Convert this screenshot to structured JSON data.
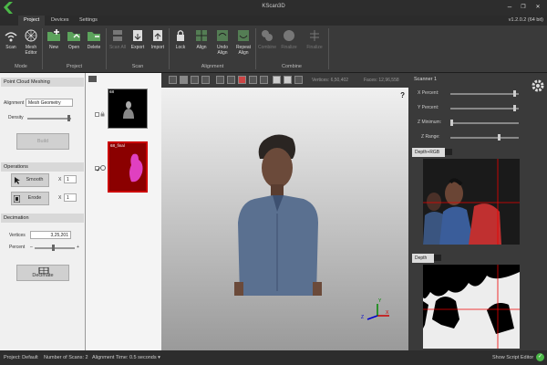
{
  "window": {
    "title": "KScan3D",
    "version": "v1.2.0.2 (64 bit)",
    "tabs": [
      "Project",
      "Devices",
      "Settings"
    ],
    "minimize": "–",
    "maximize": "❐",
    "close": "✕"
  },
  "ribbon": {
    "mode": {
      "label": "Mode",
      "buttons": [
        "Scan",
        "Mesh Editor"
      ]
    },
    "project": {
      "label": "Project",
      "buttons": [
        "New",
        "Open",
        "Delete"
      ]
    },
    "scan": {
      "label": "Scan",
      "buttons": [
        "Scan All",
        "Export",
        "Import"
      ]
    },
    "alignment": {
      "label": "Alignment",
      "buttons": [
        "Lock",
        "Align",
        "Undo Align",
        "Repeat Align"
      ]
    },
    "combine": {
      "label": "Combine",
      "buttons": [
        "Combine",
        "Finalize",
        "Finalize"
      ]
    }
  },
  "left_panel": {
    "meshing": {
      "header": "Point Cloud Meshing",
      "alignment_label": "Alignment",
      "alignment_value": "Mesh Geometry",
      "density_label": "Density",
      "build_label": "Build"
    },
    "operations": {
      "header": "Operations",
      "smooth_label": "Smooth",
      "smooth_x": "X",
      "smooth_value": "1",
      "erode_label": "Erode",
      "erode_x": "X",
      "erode_value": "1"
    },
    "decimation": {
      "header": "Decimation",
      "vertices_label": "Vertices",
      "vertices_value": "3,25,201",
      "percent_label": "Percent",
      "minus": "–",
      "plus": "+",
      "decimate_label": "Decimate"
    }
  },
  "scans": [
    {
      "label": "68",
      "selected": false
    },
    {
      "label": "68_final",
      "selected": true
    }
  ],
  "viewport": {
    "vertices_label": "Vertices: ",
    "vertices_value": "6,50,402",
    "faces_label": "Faces: ",
    "faces_value": "12,96,558",
    "help": "?",
    "axis_z": "Z",
    "axis_x": "X",
    "axis_y": "Y"
  },
  "right_panel": {
    "header": "Scanner 1",
    "x_percent": "X Percent:",
    "y_percent": "Y Percent:",
    "z_minimum": "Z Minimum:",
    "z_range": "Z Range:",
    "depth_rgb": "Depth+RGB",
    "depth": "Depth"
  },
  "status": {
    "project": "Project: Default",
    "num_scans": "Number of Scans:  2",
    "alignment_time": "Alignment Time:  0.5 seconds",
    "show_script": "Show Script Editor",
    "check": "✓"
  }
}
